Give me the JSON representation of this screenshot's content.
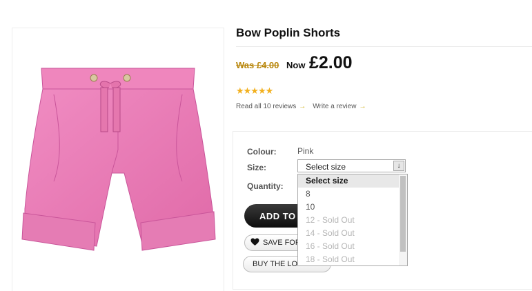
{
  "product": {
    "title": "Bow Poplin Shorts",
    "was_price": "Was £4.00",
    "now_label": "Now",
    "now_price": "£2.00",
    "rating": {
      "stars": "★★★★★",
      "value": 5,
      "max": 5
    },
    "reviews_link": "Read all 10 reviews",
    "write_review_link": "Write a review",
    "image_icon": "pink-shorts-image"
  },
  "options": {
    "colour_label": "Colour:",
    "colour_value": "Pink",
    "size_label": "Size:",
    "size_selected": "Select size",
    "quantity_label": "Quantity:",
    "size_options": [
      {
        "label": "Select size",
        "state": "selected"
      },
      {
        "label": "8",
        "state": "available"
      },
      {
        "label": "10",
        "state": "available"
      },
      {
        "label": "12 - Sold Out",
        "state": "disabled"
      },
      {
        "label": "14 - Sold Out",
        "state": "disabled"
      },
      {
        "label": "16 - Sold Out",
        "state": "disabled"
      },
      {
        "label": "18 - Sold Out",
        "state": "disabled"
      }
    ]
  },
  "actions": {
    "add_to_bag": "ADD TO BAG",
    "save_for_later": "SAVE FOR LATER",
    "buy_the_look": "BUY THE LOOK"
  },
  "colors": {
    "shorts_pink": "#ea7ab4",
    "was_price": "#b8860b",
    "stars": "#f2b01e",
    "arrow": "#c9a800"
  }
}
